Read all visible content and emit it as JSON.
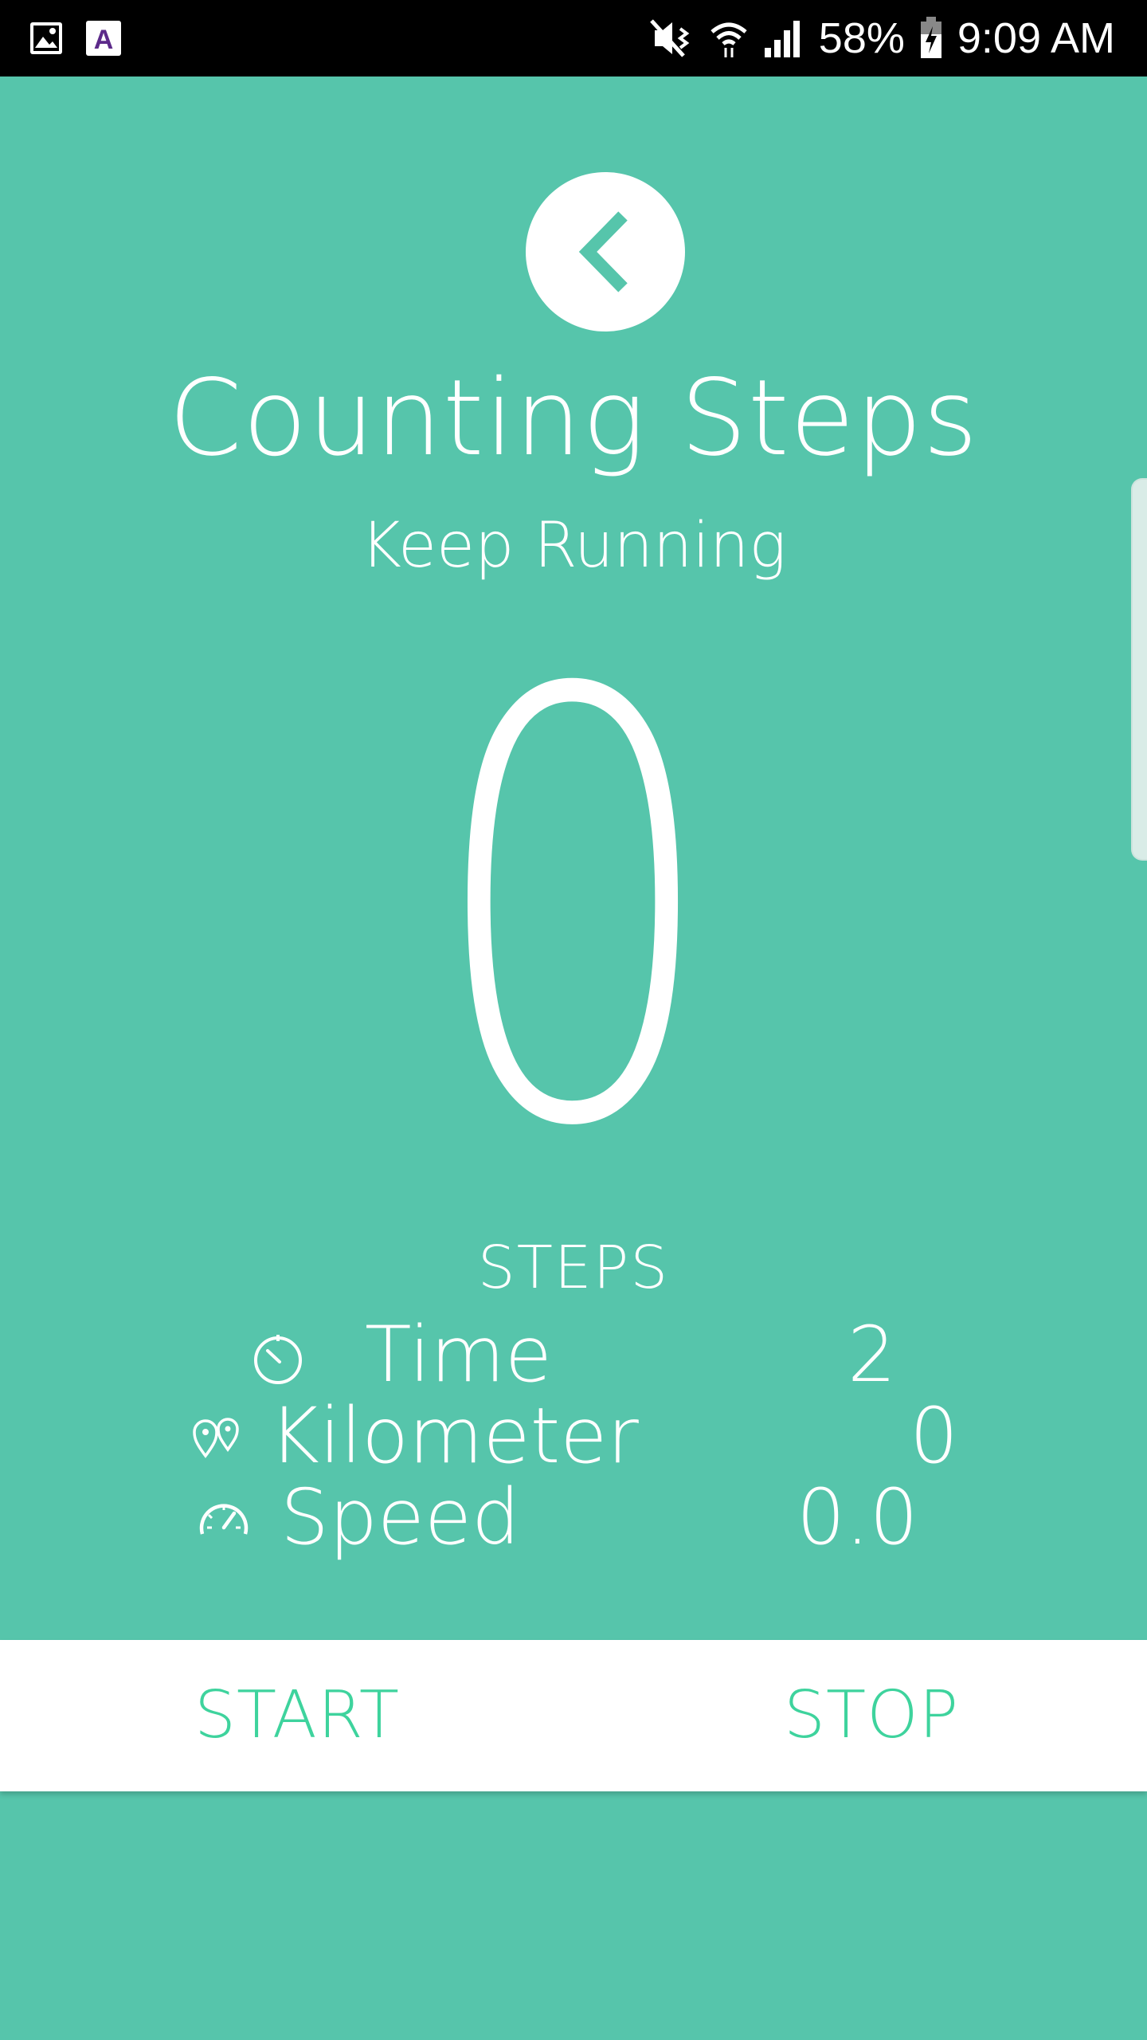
{
  "status_bar": {
    "battery_percent": "58%",
    "time": "9:09 AM",
    "left_icons": [
      "image-icon",
      "font-app-icon"
    ],
    "right_icons": [
      "mute-vibrate-icon",
      "wifi-icon",
      "signal-icon",
      "battery-charging-icon"
    ]
  },
  "header": {
    "back_icon": "chevron-left-icon",
    "title": "Counting Steps",
    "subtitle": "Keep Running"
  },
  "counter": {
    "value": "0",
    "label": "STEPS"
  },
  "stats": [
    {
      "icon": "stopwatch-icon",
      "label": "Time",
      "value": "2"
    },
    {
      "icon": "map-pins-icon",
      "label": "Kilometer",
      "value": "0"
    },
    {
      "icon": "speedometer-icon",
      "label": "Speed",
      "value": "0.0"
    }
  ],
  "buttons": {
    "start_label": "START",
    "stop_label": "STOP"
  },
  "colors": {
    "background": "#56c5ab",
    "button_text": "#3ed39d",
    "button_bar": "#ffffff",
    "status_bar": "#000000"
  }
}
